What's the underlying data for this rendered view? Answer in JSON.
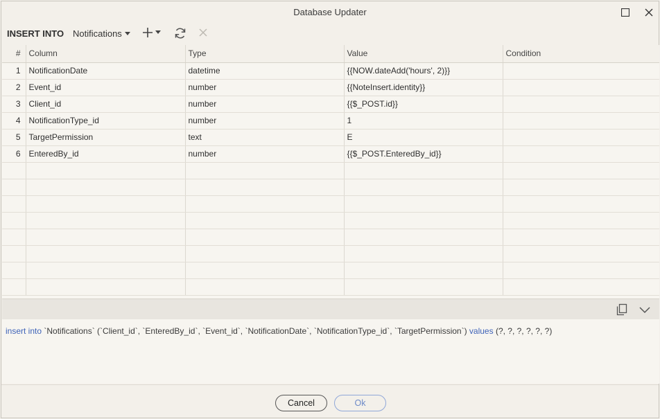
{
  "window": {
    "title": "Database Updater"
  },
  "toolbar": {
    "label": "INSERT INTO",
    "table_name": "Notifications"
  },
  "grid": {
    "headers": {
      "num": "#",
      "column": "Column",
      "type": "Type",
      "value": "Value",
      "condition": "Condition"
    },
    "rows": [
      {
        "num": "1",
        "column": "NotificationDate",
        "type": "datetime",
        "value": "{{NOW.dateAdd('hours', 2)}}",
        "condition": ""
      },
      {
        "num": "2",
        "column": "Event_id",
        "type": "number",
        "value": "{{NoteInsert.identity}}",
        "condition": ""
      },
      {
        "num": "3",
        "column": "Client_id",
        "type": "number",
        "value": "{{$_POST.id}}",
        "condition": ""
      },
      {
        "num": "4",
        "column": "NotificationType_id",
        "type": "number",
        "value": "1",
        "condition": ""
      },
      {
        "num": "5",
        "column": "TargetPermission",
        "type": "text",
        "value": "E",
        "condition": ""
      },
      {
        "num": "6",
        "column": "EnteredBy_id",
        "type": "number",
        "value": "{{$_POST.EnteredBy_id}}",
        "condition": ""
      }
    ]
  },
  "sql": {
    "kw_insert": "insert into",
    "body": " `Notifications` (`Client_id`, `EnteredBy_id`, `Event_id`, `NotificationDate`, `NotificationType_id`, `TargetPermission`) ",
    "kw_values": "values",
    "tail": " (?, ?, ?, ?, ?, ?)"
  },
  "footer": {
    "cancel_label": "Cancel",
    "ok_label": "Ok"
  },
  "colors": {
    "accent": "#3f63b8",
    "ok_border": "#8fa7d8"
  }
}
